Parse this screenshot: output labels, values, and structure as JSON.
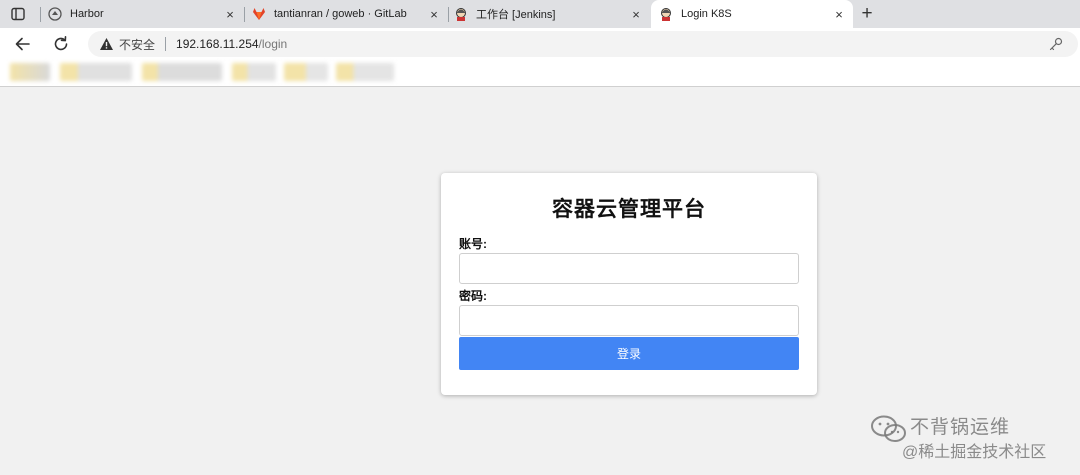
{
  "browser": {
    "tabs": [
      {
        "title": "Harbor",
        "icon": "harbor-icon",
        "active": false
      },
      {
        "title": "tantianran / goweb · GitLab",
        "icon": "gitlab-icon",
        "active": false
      },
      {
        "title": "工作台 [Jenkins]",
        "icon": "jenkins-icon",
        "active": false
      },
      {
        "title": "Login K8S",
        "icon": "jenkins-icon",
        "active": true
      }
    ],
    "new_tab_label": "+",
    "close_glyph": "×",
    "address": {
      "security_label": "不安全",
      "host": "192.168.11.254",
      "path": "/login"
    }
  },
  "login": {
    "title": "容器云管理平台",
    "username_label": "账号:",
    "username_value": "",
    "password_label": "密码:",
    "password_value": "",
    "submit_label": "登录",
    "submit_color": "#4285f4"
  },
  "watermark": {
    "line1": "不背锅运维",
    "line2": "@稀土掘金技术社区"
  }
}
